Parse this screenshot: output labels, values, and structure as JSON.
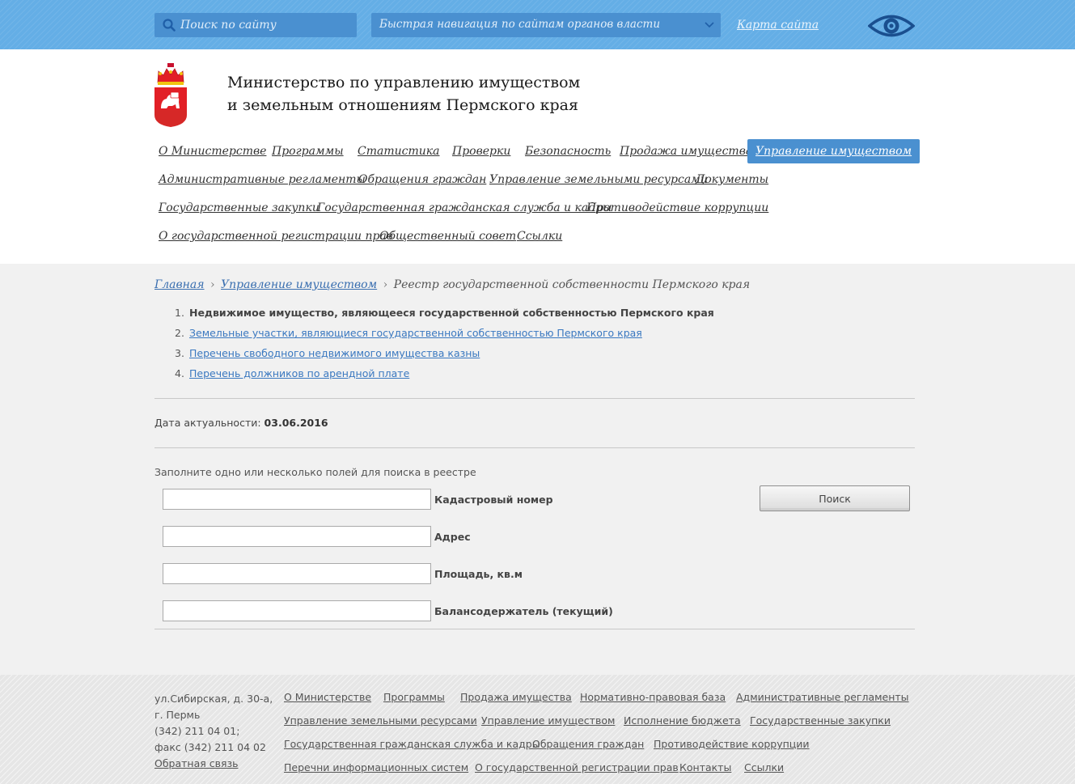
{
  "topbar": {
    "search_placeholder": "Поиск по сайту",
    "quick_nav": "Быстрая навигация по сайтам органов власти",
    "sitemap": "Карта сайта"
  },
  "header": {
    "title_line1": "Министерство по управлению имуществом",
    "title_line2": "и земельным отношениям Пермского края"
  },
  "mainnav": {
    "row1": [
      "О Министерстве",
      "Программы",
      "Статистика",
      "Проверки",
      "Безопасность",
      "Продажа имущества",
      "Управление имуществом"
    ],
    "row2": [
      "Административные регламенты",
      "Обращения граждан",
      "Управление земельными ресурсами",
      "Документы"
    ],
    "row3": [
      "Государственные закупки",
      "Государственная гражданская служба и кадры",
      "Противодействие коррупции"
    ],
    "row4": [
      "О государственной регистрации прав",
      "Общественный совет",
      "Ссылки"
    ]
  },
  "breadcrumb": {
    "home": "Главная",
    "section": "Управление имуществом",
    "current": "Реестр государственной собственности Пермского края",
    "sep": "›"
  },
  "registry_list": [
    {
      "num": "1.",
      "text": "Недвижимое имущество, являющееся государственной собственностью Пермского края"
    },
    {
      "num": "2.",
      "text": "Земельные участки, являющиеся государственной собственностью Пермского края"
    },
    {
      "num": "3.",
      "text": "Перечень свободного недвижимого имущества казны"
    },
    {
      "num": "4.",
      "text": "Перечень должников по арендной плате"
    }
  ],
  "date": {
    "label": "Дата актуальности:",
    "value": "03.06.2016"
  },
  "form": {
    "hint": "Заполните одно или несколько полей для поиска в реестре",
    "cadastral_label": "Кадастровый номер",
    "address_label": "Адрес",
    "area_label": "Площадь, кв.м",
    "holder_label": "Балансодержатель (текущий)",
    "search_button": "Поиск"
  },
  "footer": {
    "address": [
      "ул.Сибирская, д. 30-а,",
      "г. Пермь",
      "(342) 211 04 01;",
      "факс (342) 211 04 02"
    ],
    "feedback": "Обратная связь",
    "links_row1": [
      "О Министерстве",
      "Программы",
      "Продажа имущества",
      "Нормативно-правовая база",
      "Административные регламенты"
    ],
    "links_row2": [
      "Управление земельными ресурсами",
      "Управление имуществом",
      "Исполнение бюджета",
      "Государственные закупки"
    ],
    "links_row3": [
      "Государственная гражданская служба и кадры",
      "Обращения граждан",
      "Противодействие коррупции"
    ],
    "links_row4": [
      "Перечни информационных систем",
      "О государственной регистрации прав",
      "Контакты",
      "Ссылки"
    ]
  },
  "colors": {
    "topbar": "#64aee6",
    "accent": "#4a90d0",
    "link": "#3a78c0"
  }
}
